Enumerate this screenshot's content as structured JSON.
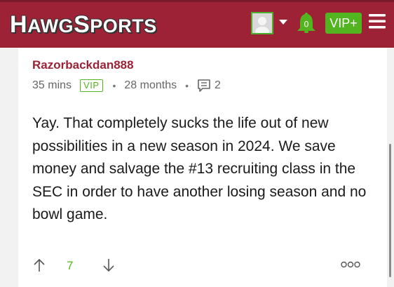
{
  "header": {
    "logo_prefix_big": "H",
    "logo_prefix_small": "AWG",
    "logo_suffix_big": "S",
    "logo_suffix_small": "PORTS",
    "notification_count": "0",
    "vip_label": "VIP+",
    "brand_color": "#9d2235",
    "accent_color": "#52b520"
  },
  "comment": {
    "username": "Razorbackdan888",
    "posted_ago": "35 mins",
    "badge": "VIP",
    "member_for": "28 months",
    "reply_count": "2",
    "text": "Yay. That completely sucks the life out of new possibilities in a new season in 2024. We save money and salvage the #13 recruiting class in the SEC in order to have another losing season and no bowl game.",
    "vote_count": "7"
  },
  "icons": [
    "avatar-icon",
    "caret-down-icon",
    "bell-icon",
    "hamburger-menu-icon",
    "reply-count-icon",
    "upvote-arrow-icon",
    "downvote-arrow-icon",
    "more-options-icon"
  ]
}
